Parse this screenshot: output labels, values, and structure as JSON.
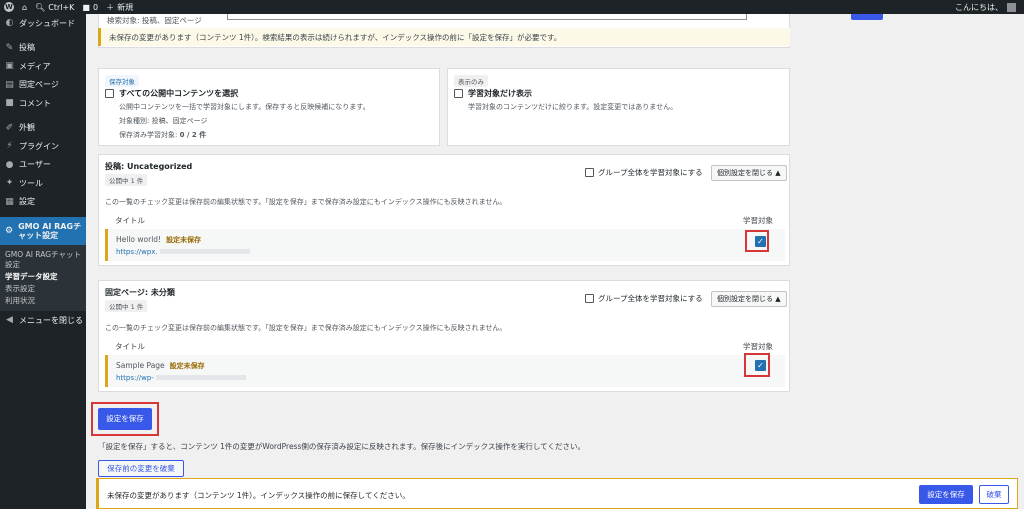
{
  "adminbar": {
    "shortcut": "Ctrl+K",
    "comments_count": "0",
    "new_label": "新規",
    "greeting": "こんにちは、"
  },
  "sidebar": {
    "items": [
      {
        "label": "ダッシュボード",
        "icon": "dashboard-icon"
      },
      {
        "label": "投稿",
        "icon": "pin-icon"
      },
      {
        "label": "メディア",
        "icon": "media-icon"
      },
      {
        "label": "固定ページ",
        "icon": "page-icon"
      },
      {
        "label": "コメント",
        "icon": "comment-icon"
      },
      {
        "label": "外観",
        "icon": "brush-icon"
      },
      {
        "label": "プラグイン",
        "icon": "plugin-icon"
      },
      {
        "label": "ユーザー",
        "icon": "user-icon"
      },
      {
        "label": "ツール",
        "icon": "wrench-icon"
      },
      {
        "label": "設定",
        "icon": "settings-icon"
      }
    ],
    "current": {
      "label": "GMO AI RAGチャット設定",
      "icon": "gear-icon"
    },
    "submenu": [
      "GMO AI RAGチャット設定",
      "学習データ設定",
      "表示設定",
      "利用状況"
    ],
    "collapse_label": "メニューを閉じる"
  },
  "top": {
    "search_target_text": "検索対象: 投稿、固定ページ",
    "notice": "未保存の変更があります（コンテンツ 1件）。検索結果の表示は続けられますが、インデックス操作の前に「設定を保存」が必要です。"
  },
  "save_target": {
    "tag": "保存対象",
    "checkbox_label": "すべての公開中コンテンツを選択",
    "desc": "公開中コンテンツを一括で学習対象にします。保存すると反映候補になります。",
    "types": "対象種別: 投稿、固定ページ",
    "count_label": "保存済み学習対象: ",
    "count_value": "0 / 2 件"
  },
  "display_only": {
    "tag": "表示のみ",
    "checkbox_label": "学習対象だけ表示",
    "desc": "学習対象のコンテンツだけに絞ります。設定変更ではありません。"
  },
  "groups": [
    {
      "title": "投稿: Uncategorized",
      "badge": "公開中 1 件",
      "group_toggle": "グループ全体を学習対象にする",
      "collapse": "個別設定を閉じる ▲",
      "note": "この一覧のチェック変更は保存前の編集状態です。「設定を保存」まで保存済み設定にもインデックス操作にも反映されません。",
      "col_title": "タイトル",
      "col_target": "学習対象",
      "row": {
        "title": "Hello world!",
        "status": "設定未保存",
        "url": "https://wpx."
      }
    },
    {
      "title": "固定ページ: 未分類",
      "badge": "公開中 1 件",
      "group_toggle": "グループ全体を学習対象にする",
      "collapse": "個別設定を閉じる ▲",
      "note": "この一覧のチェック変更は保存前の編集状態です。「設定を保存」まで保存済み設定にもインデックス操作にも反映されません。",
      "col_title": "タイトル",
      "col_target": "学習対象",
      "row": {
        "title": "Sample Page",
        "status": "設定未保存",
        "url": "https://wp-"
      }
    }
  ],
  "save_button": "設定を保存",
  "save_note": "「設定を保存」すると、コンテンツ 1件の変更がWordPress側の保存済み設定に反映されます。保存後にインデックス操作を実行してください。",
  "discard_unsaved": "保存前の変更を破棄",
  "footer_bar": {
    "message": "未保存の変更があります（コンテンツ 1件）。インデックス操作の前に保存してください。",
    "save": "設定を保存",
    "discard": "破棄"
  },
  "colors": {
    "primary": "#3858e9",
    "highlight": "#d63638",
    "warning": "#dba617"
  }
}
